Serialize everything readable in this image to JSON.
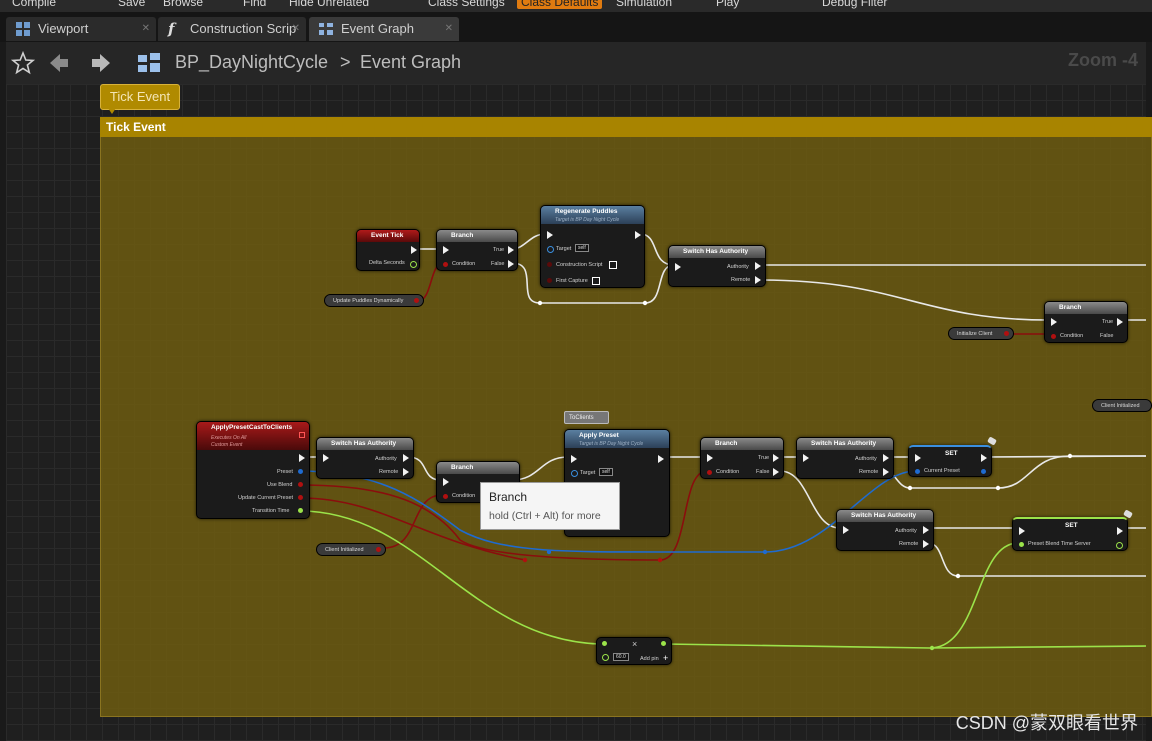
{
  "toolbar": {
    "items": [
      "Compile",
      "Save",
      "Browse",
      "Find",
      "Hide Unrelated",
      "Class Settings",
      "Class Defaults",
      "Simulation",
      "Play",
      "Debug Filter"
    ]
  },
  "tabs": [
    {
      "label": "Viewport",
      "icon": "viewport-icon"
    },
    {
      "label": "Construction Scrip",
      "icon": "function-icon"
    },
    {
      "label": "Event Graph",
      "icon": "graph-icon"
    }
  ],
  "nav": {
    "breadcrumb_root": "BP_DayNightCycle",
    "separator": ">",
    "breadcrumb_leaf": "Event Graph",
    "zoom": "Zoom -4"
  },
  "comment": {
    "bubble": "Tick Event",
    "title": "Tick Event"
  },
  "nodes": {
    "event_tick": {
      "title": "Event Tick",
      "pin": "Delta Seconds"
    },
    "branch1": {
      "title": "Branch",
      "cond": "Condition",
      "t": "True",
      "f": "False"
    },
    "regen": {
      "title": "Regenerate Puddles",
      "sub": "Target is BP Day Night Cycle",
      "target": "Target",
      "self": "self",
      "p1": "Construction Script",
      "p2": "First Capture"
    },
    "sha1": {
      "title": "Switch Has Authority",
      "a": "Authority",
      "r": "Remote"
    },
    "var_update": "Update Puddles Dynamically",
    "branch2": {
      "title": "Branch",
      "cond": "Condition",
      "t": "True",
      "f": "False"
    },
    "var_init": "Initialize Client",
    "var_client_r": "Client Initialized",
    "apply_event": {
      "title": "ApplyPresetCastToClients",
      "sub1": "Executes On All",
      "sub2": "Custom Event",
      "preset": "Preset",
      "blend": "Use Blend",
      "ucp": "Update Current Preset",
      "tt": "Transition Time"
    },
    "sha2": {
      "title": "Switch Has Authority",
      "a": "Authority",
      "r": "Remote"
    },
    "branch3": {
      "title": "Branch",
      "cond": "Condition"
    },
    "to_clients": "ToClients",
    "apply_preset": {
      "title": "Apply Preset",
      "sub": "Target is BP Day Night Cycle",
      "target": "Target",
      "self": "self"
    },
    "branch4": {
      "title": "Branch",
      "cond": "Condition",
      "t": "True",
      "f": "False"
    },
    "sha3": {
      "title": "Switch Has Authority",
      "a": "Authority",
      "r": "Remote"
    },
    "set1": {
      "title": "SET",
      "pin": "Current Preset"
    },
    "sha4": {
      "title": "Switch Has Authority",
      "a": "Authority",
      "r": "Remote"
    },
    "set2": {
      "title": "SET",
      "pin": "Preset Blend Time Server"
    },
    "var_client_l": "Client Initialized",
    "mult": {
      "value": "60.0",
      "addpin": "Add pin",
      "op": "×"
    }
  },
  "tooltip": {
    "title": "Branch",
    "hint": "hold (Ctrl + Alt) for more"
  },
  "watermark": "CSDN @蒙双眼看世界",
  "colors": {
    "exec": "#f2f2f2",
    "bool": "#9a0000",
    "struct": "#1f6bd0",
    "float": "#9be34a",
    "comment": "#a88400"
  }
}
